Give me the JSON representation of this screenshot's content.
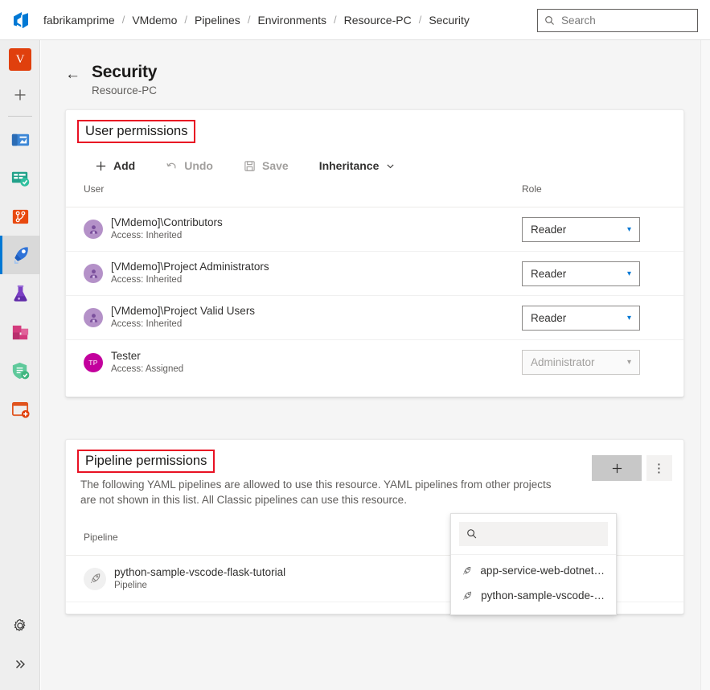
{
  "topbar": {
    "logo": "azure-devops-logo",
    "breadcrumb": [
      "fabrikamprime",
      "VMdemo",
      "Pipelines",
      "Environments",
      "Resource-PC",
      "Security"
    ],
    "separator": "/",
    "search": {
      "placeholder": "Search",
      "value": "",
      "icon": "search-icon"
    }
  },
  "rail": {
    "user_initial": "V",
    "add_label": "+",
    "items": [
      {
        "name": "overview",
        "icon": "overview-icon"
      },
      {
        "name": "boards",
        "icon": "boards-icon"
      },
      {
        "name": "repos",
        "icon": "repos-icon"
      },
      {
        "name": "pipelines",
        "icon": "pipelines-rocket-icon",
        "active": true
      },
      {
        "name": "test-plans",
        "icon": "test-plans-flask-icon"
      },
      {
        "name": "artifacts",
        "icon": "artifacts-boxes-icon"
      },
      {
        "name": "advanced-security",
        "icon": "shield-icon"
      },
      {
        "name": "add-extension",
        "icon": "add-card-icon"
      }
    ],
    "settings_icon": "gear-icon",
    "expand_icon": "double-chevron-right-icon"
  },
  "page": {
    "back_icon": "back-arrow-icon",
    "title": "Security",
    "subtitle": "Resource-PC"
  },
  "user_permissions": {
    "title": "User permissions",
    "toolbar": [
      {
        "label": "Add",
        "icon": "plus-icon",
        "disabled": false
      },
      {
        "label": "Undo",
        "icon": "undo-icon",
        "disabled": true
      },
      {
        "label": "Save",
        "icon": "save-disk-icon",
        "disabled": true
      },
      {
        "label": "Inheritance",
        "icon": "chevron-down-icon",
        "disabled": false
      }
    ],
    "columns": [
      "User",
      "Role"
    ],
    "rows": [
      {
        "name": "[VMdemo]\\Contributors",
        "access": "Access: Inherited",
        "role": "Reader",
        "avatar": "group",
        "role_disabled": false
      },
      {
        "name": "[VMdemo]\\Project Administrators",
        "access": "Access: Inherited",
        "role": "Reader",
        "avatar": "group",
        "role_disabled": false
      },
      {
        "name": "[VMdemo]\\Project Valid Users",
        "access": "Access: Inherited",
        "role": "Reader",
        "avatar": "group",
        "role_disabled": false
      },
      {
        "name": "Tester",
        "access": "Access: Assigned",
        "role": "Administrator",
        "avatar": "TP",
        "role_disabled": true
      }
    ]
  },
  "pipeline_permissions": {
    "title": "Pipeline permissions",
    "description": "The following YAML pipelines are allowed to use this resource. YAML pipelines from other projects are not shown in this list. All Classic pipelines can use this resource.",
    "column": "Pipeline",
    "add_button": "+",
    "more_button": "⋮",
    "rows": [
      {
        "name": "python-sample-vscode-flask-tutorial",
        "type": "Pipeline",
        "icon": "pipeline-rocket-icon"
      }
    ]
  },
  "pipeline_flyout": {
    "search": {
      "placeholder": "",
      "value": "",
      "icon": "search-icon"
    },
    "items": [
      {
        "label": "app-service-web-dotnet…",
        "icon": "pipeline-rocket-icon"
      },
      {
        "label": "python-sample-vscode-…",
        "icon": "pipeline-rocket-icon"
      }
    ]
  },
  "colors": {
    "accent": "#0078d4",
    "annotation": "#e81123",
    "page_bg": "#f5f5f5",
    "rail_bg": "#eeeeee",
    "user_badge": "#e0400d",
    "avatar_group": "#b491c8",
    "avatar_initials": "#c3009d"
  }
}
